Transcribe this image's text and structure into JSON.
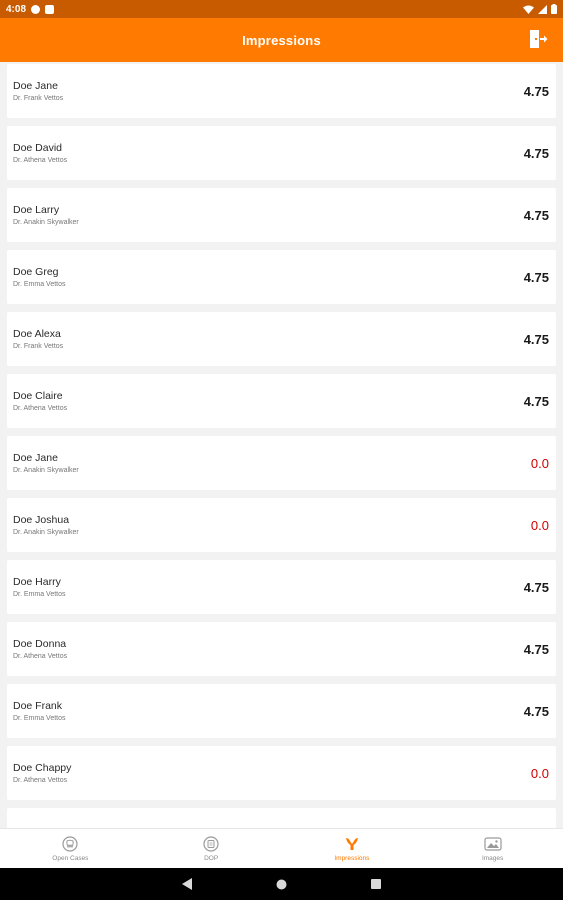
{
  "status_bar": {
    "time": "4:08"
  },
  "app_bar": {
    "title": "Impressions"
  },
  "impressions": [
    {
      "name": "Doe Jane",
      "doctor": "Dr. Frank Vettos",
      "score": "4.75"
    },
    {
      "name": "Doe David",
      "doctor": "Dr. Athena Vettos",
      "score": "4.75"
    },
    {
      "name": "Doe Larry",
      "doctor": "Dr. Anakin Skywalker",
      "score": "4.75"
    },
    {
      "name": "Doe Greg",
      "doctor": "Dr. Emma Vettos",
      "score": "4.75"
    },
    {
      "name": "Doe Alexa",
      "doctor": "Dr. Frank Vettos",
      "score": "4.75"
    },
    {
      "name": "Doe Claire",
      "doctor": "Dr. Athena Vettos",
      "score": "4.75"
    },
    {
      "name": "Doe Jane",
      "doctor": "Dr. Anakin Skywalker",
      "score": "0.0"
    },
    {
      "name": "Doe Joshua",
      "doctor": "Dr. Anakin Skywalker",
      "score": "0.0"
    },
    {
      "name": "Doe Harry",
      "doctor": "Dr. Emma Vettos",
      "score": "4.75"
    },
    {
      "name": "Doe Donna",
      "doctor": "Dr. Athena Vettos",
      "score": "4.75"
    },
    {
      "name": "Doe Frank",
      "doctor": "Dr. Emma Vettos",
      "score": "4.75"
    },
    {
      "name": "Doe Chappy",
      "doctor": "Dr. Athena Vettos",
      "score": "0.0"
    }
  ],
  "bottom_nav": {
    "items": [
      {
        "label": "Open Cases",
        "icon": "tooth-icon",
        "active": false
      },
      {
        "label": "DOP",
        "icon": "dop-icon",
        "active": false
      },
      {
        "label": "Impressions",
        "icon": "impressions-icon",
        "active": true
      },
      {
        "label": "Images",
        "icon": "images-icon",
        "active": false
      }
    ]
  },
  "colors": {
    "accent": "#ff7a00",
    "status_bar": "#c85a00",
    "zero_score": "#d10000"
  }
}
